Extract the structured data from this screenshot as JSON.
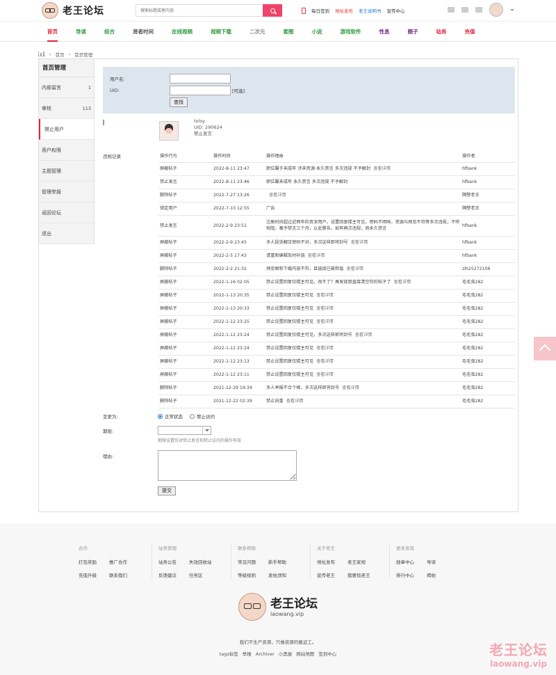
{
  "header": {
    "site_name": "老王论坛",
    "search_placeholder": "搜索标题或者内容",
    "links": [
      {
        "label": "每日签到",
        "color": "#333333"
      },
      {
        "label": "地址发布",
        "color": "#e33333"
      },
      {
        "label": "老王说明书",
        "color": "#2a7bd1"
      },
      {
        "label": "宣传中心",
        "color": "#333333"
      }
    ]
  },
  "nav": [
    {
      "label": "首页",
      "color": "#e0243b",
      "active": true
    },
    {
      "label": "导读",
      "color": "#2e9a3c"
    },
    {
      "label": "综合",
      "color": "#2e9a3c"
    },
    {
      "label": "贤者时间",
      "color": "#555555"
    },
    {
      "label": "在线视频",
      "color": "#2e9a3c"
    },
    {
      "label": "视频下载",
      "color": "#2e9a3c"
    },
    {
      "label": "二次元",
      "color": "#888888"
    },
    {
      "label": "套图",
      "color": "#2e9a3c"
    },
    {
      "label": "小说",
      "color": "#2e9a3c"
    },
    {
      "label": "游戏软件",
      "color": "#2e9a3c"
    },
    {
      "label": "性息",
      "color": "#7b2f8e"
    },
    {
      "label": "圈子",
      "color": "#7b2f8e"
    },
    {
      "label": "站务",
      "color": "#e0243b"
    },
    {
      "label": "充值",
      "color": "#e0243b"
    }
  ],
  "breadcrumb": [
    "首页",
    "首页管理"
  ],
  "sidebar": {
    "title": "首页管理",
    "items": [
      {
        "label": "内部留言",
        "count": "1"
      },
      {
        "label": "审核",
        "count": "113"
      },
      {
        "label": "禁止用户",
        "count": "",
        "active": true
      },
      {
        "label": "用户权限",
        "count": ""
      },
      {
        "label": "主题管理",
        "count": ""
      },
      {
        "label": "管理举报",
        "count": ""
      },
      {
        "label": "返回论坛",
        "count": ""
      },
      {
        "label": "退出",
        "count": ""
      }
    ]
  },
  "filter": {
    "username_label": "用户名:",
    "uid_label": "UID:",
    "optional_note": "[可选]",
    "search_button": "查找"
  },
  "user": {
    "name": "toloy",
    "uid": "UID: 290624",
    "status": "禁止发言"
  },
  "records": {
    "label": "违规记录",
    "headers": [
      "操作行为",
      "操作时间",
      "操作理由",
      "操作者"
    ],
    "detail_label": "查看详情",
    "rows": [
      {
        "action": "屏蔽帖子",
        "time": "2022-8-11 23:47",
        "reason": "职位屬于未成年 涉未资源 永久禁言 多次违规 不予解封",
        "detail": true,
        "operator": "hfbank"
      },
      {
        "action": "禁止发言",
        "time": "2022-8-11 23:46",
        "reason": "职位屬未成年 永久禁言 多次违规 不予解封",
        "detail": false,
        "operator": "hfbank"
      },
      {
        "action": "删除帖子",
        "time": "2022-7-27 13:26",
        "reason": "",
        "detail": true,
        "operator": "隔壁老王"
      },
      {
        "action": "锁定用户",
        "time": "2022-7-10 12:55",
        "reason": "广告",
        "detail": false,
        "operator": "隔壁老王"
      },
      {
        "action": "禁止发言",
        "time": "2022-2-9 23:51",
        "reason": "注册时间超过近两年的资深用户，设置回复楼主可见，密码不明晰，资源与预览不符等多次违规，不听劝阻，毒予禁言三个月，以此警告，如有再次违规，则永久禁言",
        "detail": false,
        "operator": "hfbank",
        "tall": true
      },
      {
        "action": "屏蔽帖子",
        "time": "2022-2-9 23:45",
        "reason": "多人投诉解压密码不对，多次这样即将封号",
        "detail": true,
        "operator": "hfbank"
      },
      {
        "action": "屏蔽帖子",
        "time": "2022-2-5 17:43",
        "reason": "请重新编辑及时补链",
        "detail": true,
        "operator": "hfbank"
      },
      {
        "action": "删除帖子",
        "time": "2022-2-2 21:32",
        "reason": "预览图和下载内容不符，且链接已被和谐",
        "detail": true,
        "operator": "zlh25272106"
      },
      {
        "action": "屏蔽帖子",
        "time": "2022-1-16 02:05",
        "reason": "禁止设置回复仅楼主可见。改不了？再发现我直接清空你的帖子了",
        "detail": true,
        "operator": "毛毛虫282"
      },
      {
        "action": "屏蔽帖子",
        "time": "2022-1-13 20:35",
        "reason": "禁止设置回复仅楼主可见",
        "detail": true,
        "operator": "毛毛虫282"
      },
      {
        "action": "屏蔽帖子",
        "time": "2022-1-13 20:33",
        "reason": "禁止设置回复仅楼主可见",
        "detail": true,
        "operator": "毛毛虫282"
      },
      {
        "action": "屏蔽帖子",
        "time": "2022-1-12 23:25",
        "reason": "禁止设置回复仅楼主可见",
        "detail": true,
        "operator": "毛毛虫282"
      },
      {
        "action": "屏蔽帖子",
        "time": "2022-1-12 23:24",
        "reason": "禁止设置回复仅楼主可见，多次这样即将封号",
        "detail": true,
        "operator": "毛毛虫282"
      },
      {
        "action": "屏蔽帖子",
        "time": "2022-1-12 23:24",
        "reason": "禁止设置回复仅楼主可见",
        "detail": true,
        "operator": "毛毛虫282"
      },
      {
        "action": "屏蔽帖子",
        "time": "2022-1-12 23:13",
        "reason": "禁止设置回复仅楼主可见",
        "detail": true,
        "operator": "毛毛虫282"
      },
      {
        "action": "屏蔽帖子",
        "time": "2022-1-12 23:11",
        "reason": "禁止设置回复仅楼主可见",
        "detail": true,
        "operator": "毛毛虫282"
      },
      {
        "action": "删除帖子",
        "time": "2021-12-29 19:34",
        "reason": "多人举报不合个格，多次这样即将封号",
        "detail": true,
        "operator": "毛毛虫282"
      },
      {
        "action": "删除帖子",
        "time": "2021-12-22 02:39",
        "reason": "禁止自重",
        "detail": true,
        "operator": "毛毛虫282"
      }
    ]
  },
  "form": {
    "change_label": "变更为:",
    "option_normal": "正常状态",
    "option_banned": "禁止访问",
    "period_label": "期限:",
    "period_hint": "期限设置仅对禁止发言和禁止访问的操作有效",
    "reason_label": "理由:",
    "submit_label": "提交"
  },
  "footer": {
    "columns": [
      {
        "title": "合作",
        "links": [
          "打包奖励",
          "推广合作",
          "充值升级",
          "联系我们"
        ]
      },
      {
        "title": "站务管理",
        "links": [
          "站务公告",
          "失效回收站",
          "反馈建议",
          "任务区"
        ]
      },
      {
        "title": "联系帮助",
        "links": [
          "常见问题",
          "新手帮助",
          "等级规则",
          "发帖须知"
        ]
      },
      {
        "title": "关于老王",
        "links": [
          "地址发布",
          "老王家规",
          "宣传老王",
          "我要找老王"
        ]
      },
      {
        "title": "更多发现",
        "links": [
          "勋章中心",
          "导读",
          "排行中心",
          "揭帖"
        ]
      }
    ],
    "logo_name": "老王论坛",
    "logo_url": "laowang.vip",
    "slogan": "我们不生产资源，只做资源的搬运工。",
    "links": [
      "tags标签",
      "举报",
      "Archiver",
      "小黑屋",
      "网站地图",
      "签到中心"
    ]
  },
  "watermark": {
    "name": "老王论坛",
    "url": "laowang.vip"
  }
}
